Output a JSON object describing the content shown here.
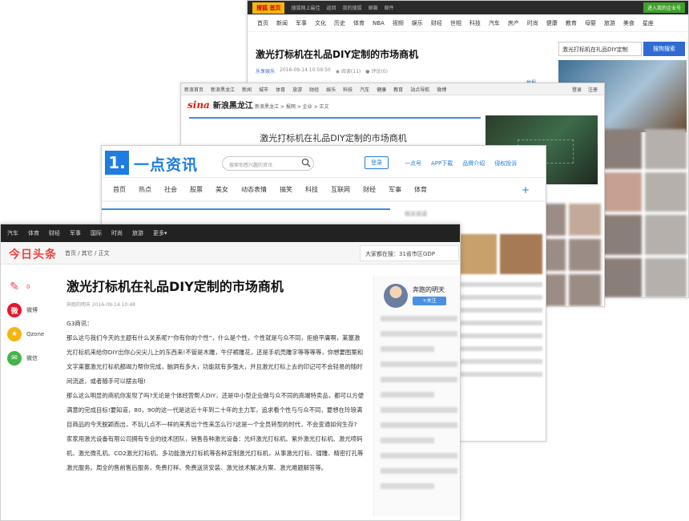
{
  "sohu": {
    "logo": "搜狐",
    "home": "首页",
    "topbar": [
      "搜狐网上最佳",
      "返回",
      "我的搜狐",
      "邮箱",
      "邮件"
    ],
    "top_right": "进入我的企业号",
    "nav": [
      "首页",
      "新闻",
      "军事",
      "文化",
      "历史",
      "体育",
      "NBA",
      "视频",
      "娱乐",
      "财经",
      "世相",
      "科技",
      "汽车",
      "房产",
      "时尚",
      "健康",
      "教育",
      "母婴",
      "旅游",
      "美食",
      "星座"
    ],
    "title": "激光打标机在礼品DIY定制的市场商机",
    "meta_source": "乐享娱乐",
    "meta_time": "2016-09-14 10:59:50",
    "meta_reads": "阅读(11)",
    "meta_comments": "评论(0)",
    "search_value": "激光打标机在礼品DIY定制",
    "search_button": "搜狗搜索",
    "more": "举报"
  },
  "sina": {
    "topnav": [
      "新浪首页",
      "新浪黑龙江",
      "新闻",
      "城市",
      "体育",
      "旅游",
      "财经",
      "娱乐",
      "科技",
      "汽车",
      "健康",
      "教育",
      "站点导航",
      "微博"
    ],
    "topnav_right": [
      "登录",
      "注册"
    ],
    "logo": "sina",
    "brand": "新浪黑龙江",
    "crumb": "新浪黑龙江 > 报网 > 企业 > 正文",
    "title": "激光打标机在礼品DIY定制的市场商机"
  },
  "yidian": {
    "logo_mark": "1.",
    "brand": "一点资讯",
    "search_placeholder": "搜索你感兴趣的资讯",
    "login": "登录",
    "links": [
      "一点号",
      "APP下载",
      "品牌介绍",
      "侵权投诉"
    ],
    "nav": [
      "首页",
      "热点",
      "社会",
      "股票",
      "美女",
      "动态表情",
      "搞笑",
      "科技",
      "互联网",
      "财经",
      "军事",
      "体育"
    ],
    "plus": "+",
    "related": "相关阅读"
  },
  "toutiao": {
    "topnav": [
      "汽车",
      "体育",
      "财经",
      "军事",
      "国际",
      "时尚",
      "旅游",
      "更多▾"
    ],
    "logo": "今日头条",
    "crumb": "首页 / 其它 / 正文",
    "trending": "大家都在搜：31省市区GDP",
    "comment_count": "0",
    "share": [
      {
        "label": "微博",
        "color": "#e6162d",
        "glyph": "微"
      },
      {
        "label": "Qzone",
        "color": "#f6b411",
        "glyph": "★"
      },
      {
        "label": "微信",
        "color": "#44b549",
        "glyph": "✉"
      }
    ],
    "title": "激光打标机在礼品DIY定制的市场商机",
    "meta": "奔跑的明天  2016-09-14 10:48",
    "body": [
      "G3商讯：",
      "那么这与我们今天的主题有什么关系呢?“你有你的个性”，什么是个性，个性就是与众不同，拒绝平庸啊，莱塞激光打标机来给你DIY出你心尖尖儿上的东西来!不管是木雕，牛仔裤雕花，还是手机壳雕字等等等等，你想要图案和文字莱塞激光打标机都竭力帮你完成，脑洞有多大，功能就有多强大，并且激光打标上去的印记可不会轻易的随时间流逝，或者随手可以摆去哦!",
      "那么这么明显的商机你发现了吗?无论是个体经营帮人DIY，还是中小型企业做与众不同的高端特卖品，都可以方便满意的完成目标!要知道，80，90的这一代是这近十年到二十年的主力军，追求看个性与与众不同，要想在玲琅满目商品的今天脱颖而出，不玩儿点不一样的来秀出个性来怎么行?这是一个全员转型的时代，不会变通如何生存?",
      "家家用激光设备有限公司拥有专业的技术团队，销售各种激光设备：光纤激光打标机、紫外激光打标机、激光喷码机、激光微孔机、CO2激光打标机、多功能激光打标机等各种定制激光打标机，从事激光打标、镭雕、精密打孔等激光服务。周全的售前售后服务，免费打样、免费送货安装、激光技术解决方案、激光难题解答等。"
    ],
    "author": "奔跑的明天",
    "follow": "+关注"
  }
}
